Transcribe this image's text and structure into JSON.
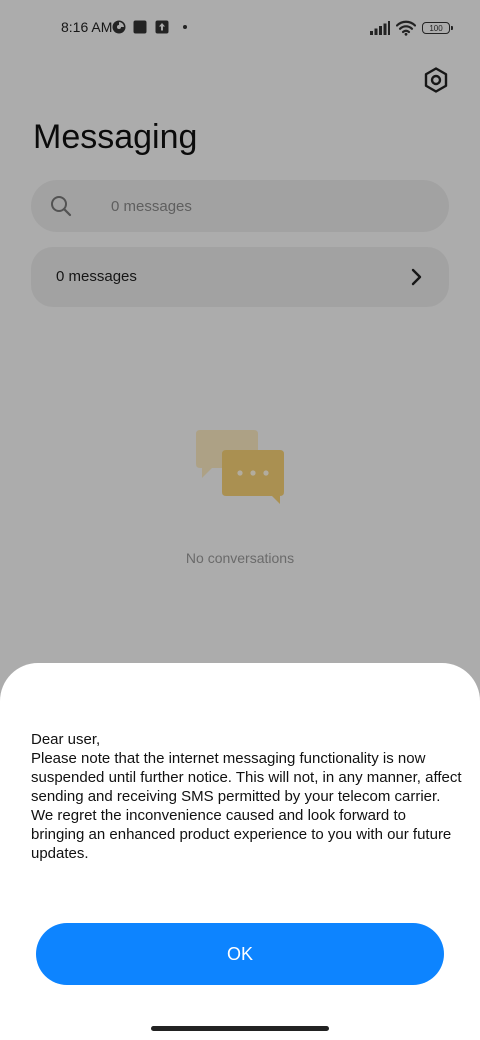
{
  "status_bar": {
    "time": "8:16 AM",
    "battery_level": "100",
    "icons": [
      "data-saver-icon",
      "square-app-icon",
      "upload-icon",
      "notification-dot-icon",
      "signal-icon",
      "wifi-icon",
      "battery-icon"
    ]
  },
  "header": {
    "title": "Messaging",
    "settings_icon": "gear-icon"
  },
  "search": {
    "placeholder": "0 messages",
    "value": ""
  },
  "messages_row": {
    "label": "0 messages"
  },
  "empty_state": {
    "text": "No conversations",
    "illustration_icon": "chat-bubbles-icon",
    "accent_color": "#f2c94c"
  },
  "dialog": {
    "message": "Dear user,\nPlease note that the internet messaging functionality is now suspended until further notice. This will not, in any manner, affect sending and receiving SMS permitted by your telecom carrier. We regret the inconvenience caused and look forward to bringing an enhanced product experience to you with our future updates.",
    "ok_label": "OK",
    "button_color": "#0d84ff"
  }
}
